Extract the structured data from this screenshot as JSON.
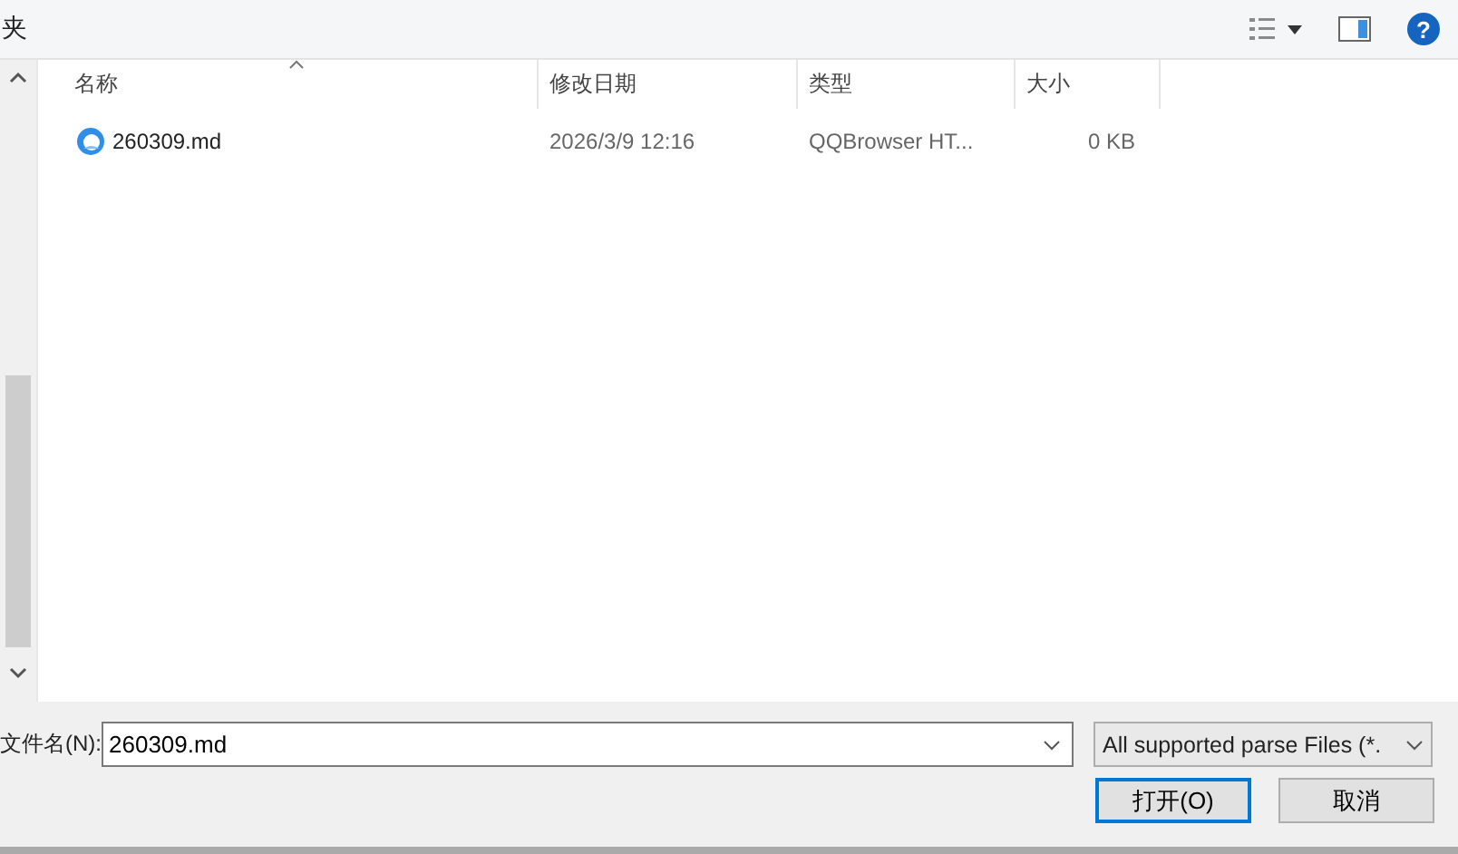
{
  "toolbar": {
    "breadcrumb": "夹",
    "help": "?"
  },
  "table": {
    "columns": [
      {
        "label": "名称",
        "sorted": true
      },
      {
        "label": "修改日期",
        "sorted": false
      },
      {
        "label": "类型",
        "sorted": false
      },
      {
        "label": "大小",
        "sorted": false
      }
    ],
    "rows": [
      {
        "name": "260309.md",
        "modified": "2026/3/9 12:16",
        "type": "QQBrowser HT...",
        "size": "0 KB",
        "selected": false
      }
    ]
  },
  "filename": {
    "label": "文件名(N):",
    "value": "260309.md"
  },
  "filter": {
    "value": "All supported parse Files (*."
  },
  "buttons": [
    {
      "label": "打开(O)",
      "default": true
    },
    {
      "label": "取消",
      "default": false
    }
  ]
}
